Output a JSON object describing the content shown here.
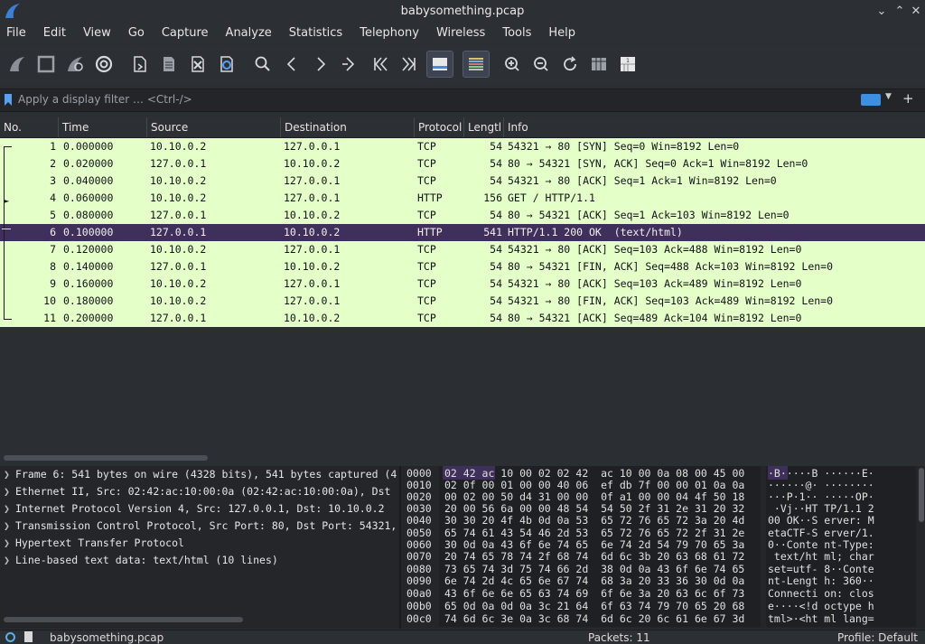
{
  "window": {
    "title": "babysomething.pcap"
  },
  "menu": [
    "File",
    "Edit",
    "View",
    "Go",
    "Capture",
    "Analyze",
    "Statistics",
    "Telephony",
    "Wireless",
    "Tools",
    "Help"
  ],
  "filter": {
    "placeholder": "Apply a display filter … <Ctrl-/>"
  },
  "columns": [
    "No.",
    "Time",
    "Source",
    "Destination",
    "Protocol",
    "Lengtl",
    "Info"
  ],
  "packets": [
    {
      "no": "1",
      "time": "0.000000",
      "src": "10.10.0.2",
      "dst": "127.0.0.1",
      "proto": "TCP",
      "len": "54",
      "info": "54321 → 80 [SYN] Seq=0 Win=8192 Len=0"
    },
    {
      "no": "2",
      "time": "0.020000",
      "src": "127.0.0.1",
      "dst": "10.10.0.2",
      "proto": "TCP",
      "len": "54",
      "info": "80 → 54321 [SYN, ACK] Seq=0 Ack=1 Win=8192 Len=0"
    },
    {
      "no": "3",
      "time": "0.040000",
      "src": "10.10.0.2",
      "dst": "127.0.0.1",
      "proto": "TCP",
      "len": "54",
      "info": "54321 → 80 [ACK] Seq=1 Ack=1 Win=8192 Len=0"
    },
    {
      "no": "4",
      "time": "0.060000",
      "src": "10.10.0.2",
      "dst": "127.0.0.1",
      "proto": "HTTP",
      "len": "156",
      "info": "GET / HTTP/1.1"
    },
    {
      "no": "5",
      "time": "0.080000",
      "src": "127.0.0.1",
      "dst": "10.10.0.2",
      "proto": "TCP",
      "len": "54",
      "info": "80 → 54321 [ACK] Seq=1 Ack=103 Win=8192 Len=0"
    },
    {
      "no": "6",
      "time": "0.100000",
      "src": "127.0.0.1",
      "dst": "10.10.0.2",
      "proto": "HTTP",
      "len": "541",
      "info": "HTTP/1.1 200 OK  (text/html)"
    },
    {
      "no": "7",
      "time": "0.120000",
      "src": "10.10.0.2",
      "dst": "127.0.0.1",
      "proto": "TCP",
      "len": "54",
      "info": "54321 → 80 [ACK] Seq=103 Ack=488 Win=8192 Len=0"
    },
    {
      "no": "8",
      "time": "0.140000",
      "src": "127.0.0.1",
      "dst": "10.10.0.2",
      "proto": "TCP",
      "len": "54",
      "info": "80 → 54321 [FIN, ACK] Seq=488 Ack=103 Win=8192 Len=0"
    },
    {
      "no": "9",
      "time": "0.160000",
      "src": "10.10.0.2",
      "dst": "127.0.0.1",
      "proto": "TCP",
      "len": "54",
      "info": "54321 → 80 [ACK] Seq=103 Ack=489 Win=8192 Len=0"
    },
    {
      "no": "10",
      "time": "0.180000",
      "src": "10.10.0.2",
      "dst": "127.0.0.1",
      "proto": "TCP",
      "len": "54",
      "info": "54321 → 80 [FIN, ACK] Seq=103 Ack=489 Win=8192 Len=0"
    },
    {
      "no": "11",
      "time": "0.200000",
      "src": "127.0.0.1",
      "dst": "10.10.0.2",
      "proto": "TCP",
      "len": "54",
      "info": "80 → 54321 [ACK] Seq=489 Ack=104 Win=8192 Len=0"
    }
  ],
  "details": [
    "Frame 6: 541 bytes on wire (4328 bits), 541 bytes captured (4",
    "Ethernet II, Src: 02:42:ac:10:00:0a (02:42:ac:10:00:0a), Dst",
    "Internet Protocol Version 4, Src: 127.0.0.1, Dst: 10.10.0.2",
    "Transmission Control Protocol, Src Port: 80, Dst Port: 54321,",
    "Hypertext Transfer Protocol",
    "Line-based text data: text/html (10 lines)"
  ],
  "hex": [
    {
      "off": "0000",
      "bytes": "02 42 ac 10 00 02 02 42  ac 10 00 0a 08 00 45 00",
      "ascii": "·B·····B ······E·"
    },
    {
      "off": "0010",
      "bytes": "02 0f 00 01 00 00 40 06  ef db 7f 00 00 01 0a 0a",
      "ascii": "······@· ········"
    },
    {
      "off": "0020",
      "bytes": "00 02 00 50 d4 31 00 00  0f a1 00 00 04 4f 50 18",
      "ascii": "···P·1·· ·····OP·"
    },
    {
      "off": "0030",
      "bytes": "20 00 56 6a 00 00 48 54  54 50 2f 31 2e 31 20 32",
      "ascii": " ·Vj··HT TP/1.1 2"
    },
    {
      "off": "0040",
      "bytes": "30 30 20 4f 4b 0d 0a 53  65 72 76 65 72 3a 20 4d",
      "ascii": "00 OK··S erver: M"
    },
    {
      "off": "0050",
      "bytes": "65 74 61 43 54 46 2d 53  65 72 76 65 72 2f 31 2e",
      "ascii": "etaCTF-S erver/1."
    },
    {
      "off": "0060",
      "bytes": "30 0d 0a 43 6f 6e 74 65  6e 74 2d 54 79 70 65 3a",
      "ascii": "0··Conte nt-Type:"
    },
    {
      "off": "0070",
      "bytes": "20 74 65 78 74 2f 68 74  6d 6c 3b 20 63 68 61 72",
      "ascii": " text/ht ml; char"
    },
    {
      "off": "0080",
      "bytes": "73 65 74 3d 75 74 66 2d  38 0d 0a 43 6f 6e 74 65",
      "ascii": "set=utf- 8··Conte"
    },
    {
      "off": "0090",
      "bytes": "6e 74 2d 4c 65 6e 67 74  68 3a 20 33 36 30 0d 0a",
      "ascii": "nt-Lengt h: 360··"
    },
    {
      "off": "00a0",
      "bytes": "43 6f 6e 6e 65 63 74 69  6f 6e 3a 20 63 6c 6f 73",
      "ascii": "Connecti on: clos"
    },
    {
      "off": "00b0",
      "bytes": "65 0d 0a 0d 0a 3c 21 64  6f 63 74 79 70 65 20 68",
      "ascii": "e····<!d octype h"
    },
    {
      "off": "00c0",
      "bytes": "74 6d 6c 3e 0a 3c 68 74  6d 6c 20 6c 61 6e 67 3d",
      "ascii": "tml>·<ht ml lang="
    }
  ],
  "status": {
    "file": "babysomething.pcap",
    "packets": "Packets: 11",
    "profile": "Profile: Default"
  }
}
